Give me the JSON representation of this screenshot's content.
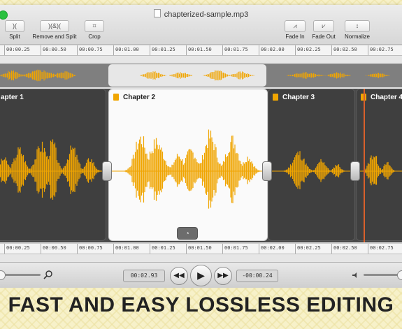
{
  "window": {
    "title": "chapterized-sample.mp3"
  },
  "toolbar": {
    "left": [
      {
        "label": "Split",
        "glyph": ")("
      },
      {
        "label": "Remove and Split",
        "glyph": ")(&)("
      },
      {
        "label": "Crop",
        "glyph": "⌗"
      }
    ],
    "right": [
      {
        "label": "Fade In",
        "glyph": "⩘"
      },
      {
        "label": "Fade Out",
        "glyph": "⩗"
      },
      {
        "label": "Normalize",
        "glyph": "↕"
      }
    ]
  },
  "ruler": {
    "ticks": [
      "00:00.25",
      "00:00.50",
      "00:00.75",
      "00:01.00",
      "00:01.25",
      "00:01.50",
      "00:01.75",
      "00:02.00",
      "00:02.25",
      "00:02.50",
      "00:02.75"
    ]
  },
  "chapters": [
    {
      "label": "apter 1",
      "selected": false
    },
    {
      "label": "Chapter 2",
      "selected": true
    },
    {
      "label": "Chapter 3",
      "selected": false
    },
    {
      "label": "Chapter 4",
      "selected": false
    }
  ],
  "transport": {
    "current_time": "00:02.93",
    "remaining_time": "-00:00.24",
    "volume_icon": "speaker-icon",
    "zoom_icon": "magnifier-icon"
  },
  "colors": {
    "waveform": "#f0a500",
    "playhead": "#d9602b",
    "accent_green": "#29c03f"
  },
  "headline": "FAST AND EASY LOSSLESS EDITING"
}
